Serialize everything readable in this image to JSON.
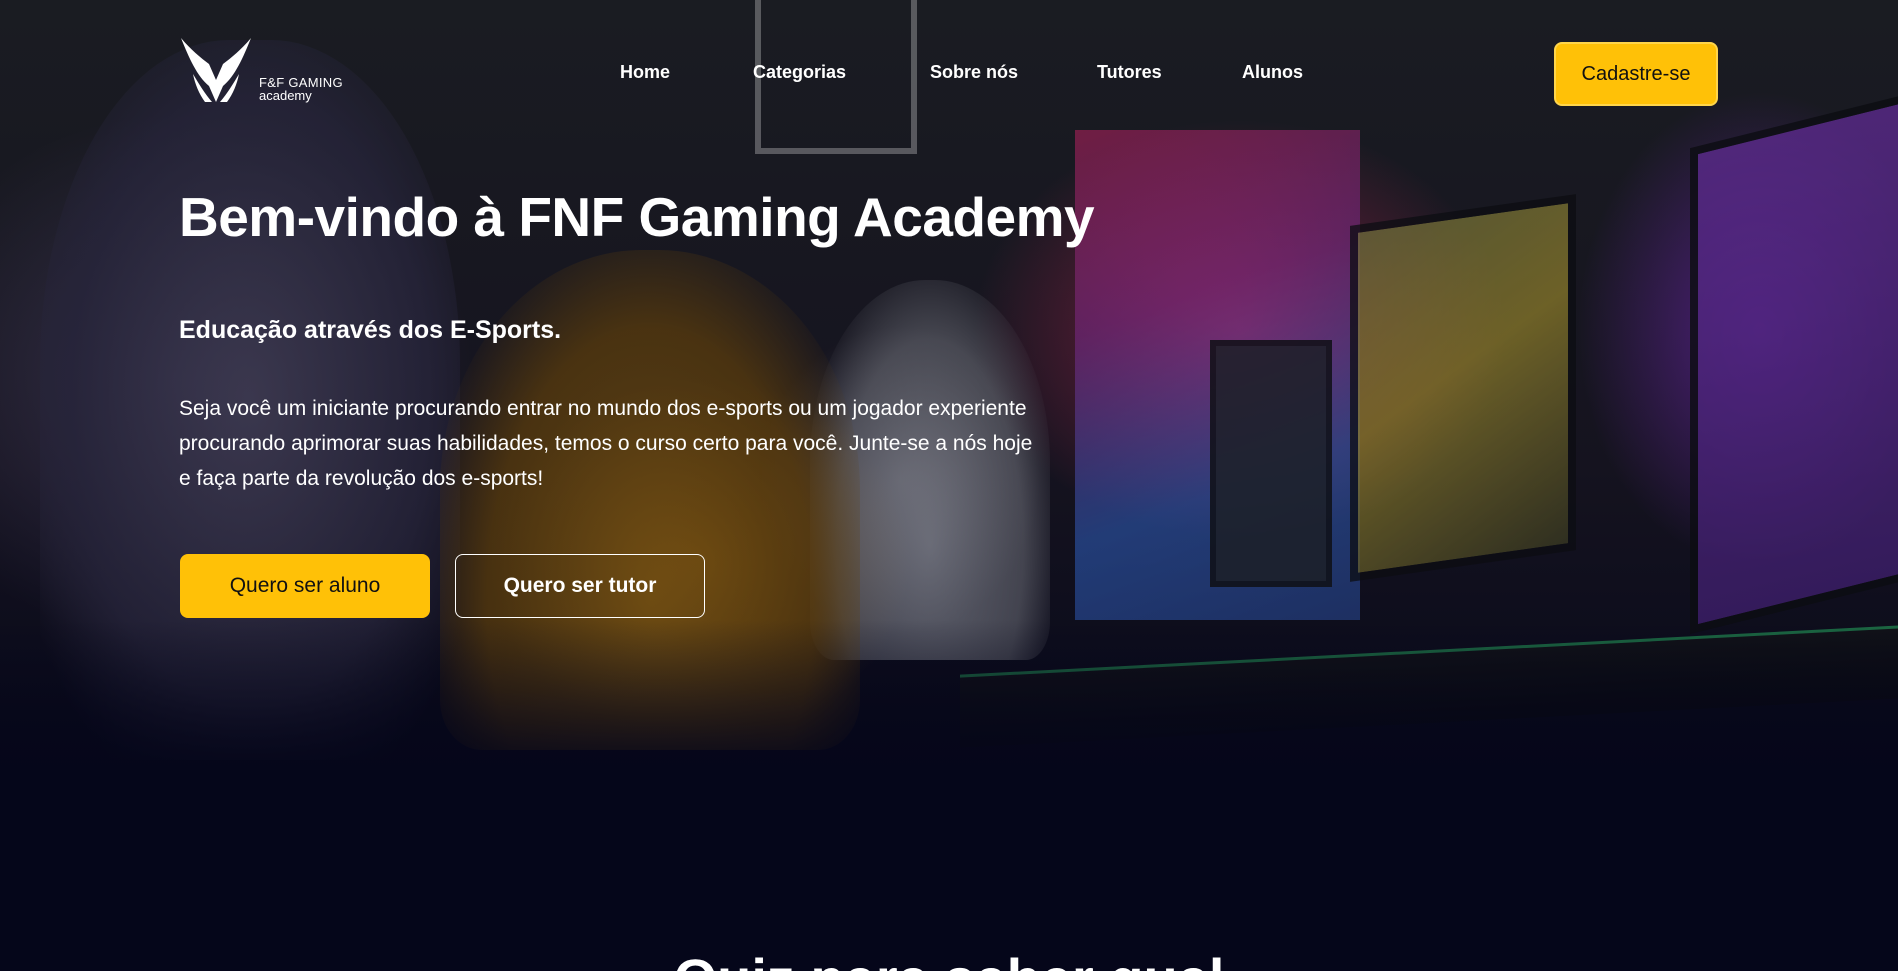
{
  "brand": {
    "logo_line1": "F&F GAMING",
    "logo_line2": "academy"
  },
  "nav": {
    "items": [
      {
        "label": "Home"
      },
      {
        "label": "Categorias"
      },
      {
        "label": "Sobre nós"
      },
      {
        "label": "Tutores"
      },
      {
        "label": "Alunos"
      }
    ],
    "signup_label": "Cadastre-se"
  },
  "hero": {
    "title": "Bem-vindo à FNF Gaming Academy",
    "subtitle": "Educação através dos E-Sports.",
    "description": "Seja você um iniciante procurando entrar no mundo dos e-sports ou um jogador experiente procurando aprimorar suas habilidades, temos o curso certo para você. Junte-se a nós hoje e faça parte da revolução dos e-sports!",
    "primary_button": "Quero ser aluno",
    "secondary_button": "Quero ser tutor"
  },
  "next_section": {
    "heading": "Quiz para saber qual"
  },
  "colors": {
    "accent": "#ffc107",
    "background": "#05061a",
    "text": "#ffffff"
  }
}
